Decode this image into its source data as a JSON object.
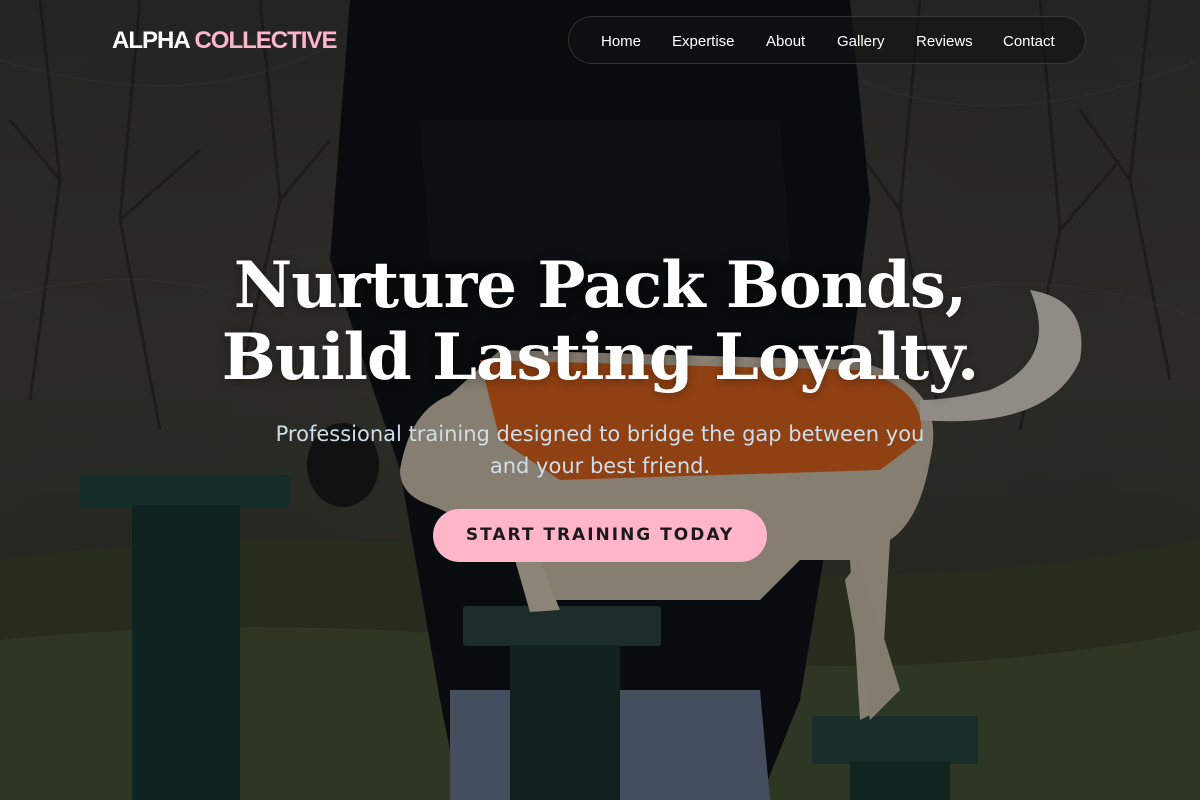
{
  "brand": {
    "name_part1": "ALPHA",
    "name_part2": "COLLECTIVE",
    "accent_color": "#ffb6c8"
  },
  "nav": {
    "items": [
      {
        "label": "Home"
      },
      {
        "label": "Expertise"
      },
      {
        "label": "About"
      },
      {
        "label": "Gallery"
      },
      {
        "label": "Reviews"
      },
      {
        "label": "Contact"
      }
    ]
  },
  "hero": {
    "headline_line1": "Nurture Pack Bonds,",
    "headline_line2": "Build Lasting Loyalty.",
    "subtitle": "Professional training designed to bridge the gap between you and your best friend.",
    "cta_label": "START TRAINING TODAY",
    "background_image": "person-training-dog-on-agility-bench-photo",
    "cta_color": "#ffb6c8"
  }
}
